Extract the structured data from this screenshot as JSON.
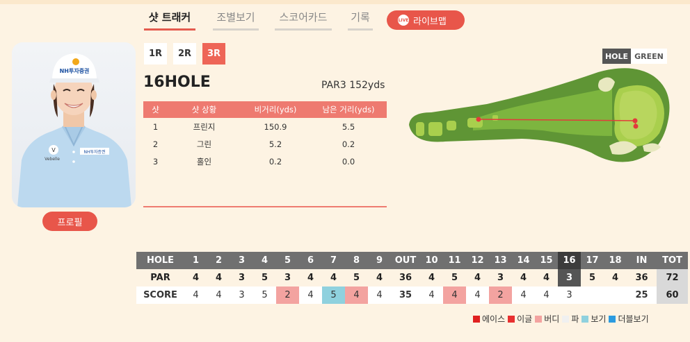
{
  "tabs": [
    {
      "label": "샷 트래커",
      "active": true
    },
    {
      "label": "조별보기",
      "active": false
    },
    {
      "label": "스코어카드",
      "active": false
    },
    {
      "label": "기록",
      "active": false
    }
  ],
  "live_map": {
    "badge": "LIVE",
    "label": "라이브맵"
  },
  "player": {
    "profile_label": "프로필",
    "cap_text": "NH투자증권",
    "shirt_text": "NH투자증권"
  },
  "rounds": [
    {
      "label": "1R",
      "active": false
    },
    {
      "label": "2R",
      "active": false
    },
    {
      "label": "3R",
      "active": true
    }
  ],
  "hole": {
    "title": "16HOLE",
    "par_info": "PAR3 152yds"
  },
  "shot_table": {
    "headers": [
      "샷",
      "샷 상황",
      "비거리(yds)",
      "남은 거리(yds)"
    ],
    "rows": [
      [
        "1",
        "프린지",
        "150.9",
        "5.5"
      ],
      [
        "2",
        "그린",
        "5.2",
        "0.2"
      ],
      [
        "3",
        "홀인",
        "0.2",
        "0.0"
      ]
    ]
  },
  "map_toggle": {
    "hole": "HOLE",
    "green": "GREEN"
  },
  "scorecard": {
    "head": [
      "HOLE",
      "1",
      "2",
      "3",
      "4",
      "5",
      "6",
      "7",
      "8",
      "9",
      "OUT",
      "10",
      "11",
      "12",
      "13",
      "14",
      "15",
      "16",
      "17",
      "18",
      "IN",
      "TOT"
    ],
    "par": [
      "PAR",
      "4",
      "4",
      "3",
      "5",
      "3",
      "4",
      "4",
      "5",
      "4",
      "36",
      "4",
      "5",
      "4",
      "3",
      "4",
      "4",
      "3",
      "5",
      "4",
      "36",
      "72"
    ],
    "score": [
      "SCORE",
      "4",
      "4",
      "3",
      "5",
      "2",
      "4",
      "5",
      "4",
      "4",
      "35",
      "4",
      "4",
      "4",
      "2",
      "4",
      "4",
      "3",
      "",
      "",
      "25",
      "60"
    ],
    "current_hole_col": 17,
    "score_types": [
      "",
      "par",
      "par",
      "par",
      "par",
      "birdie",
      "par",
      "bogey",
      "birdie",
      "par",
      "",
      "par",
      "birdie",
      "par",
      "birdie",
      "par",
      "par",
      "par",
      "",
      "",
      "",
      ""
    ]
  },
  "legend": [
    {
      "label": "에이스",
      "color": "#e02020"
    },
    {
      "label": "이글",
      "color": "#e83030"
    },
    {
      "label": "버디",
      "color": "#f3a3a0"
    },
    {
      "label": "파",
      "color": "#f0f0f0"
    },
    {
      "label": "보기",
      "color": "#8fd1de"
    },
    {
      "label": "더블보기",
      "color": "#2b9be0"
    }
  ]
}
